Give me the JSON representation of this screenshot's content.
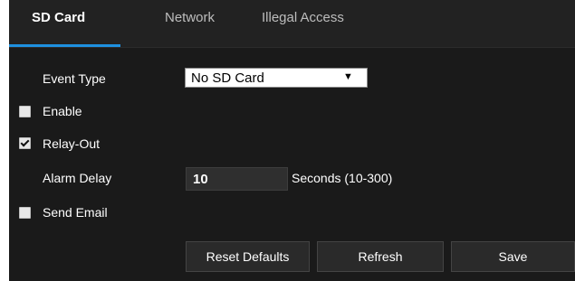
{
  "tabs": [
    {
      "label": "SD Card",
      "active": true
    },
    {
      "label": "Network",
      "active": false
    },
    {
      "label": "Illegal Access",
      "active": false
    }
  ],
  "form": {
    "event_type_label": "Event Type",
    "event_type_value": "No SD Card",
    "enable_label": "Enable",
    "enable_checked": false,
    "relay_out_label": "Relay-Out",
    "relay_out_checked": true,
    "alarm_delay_label": "Alarm Delay",
    "alarm_delay_value": "10",
    "alarm_delay_hint": "Seconds (10-300)",
    "send_email_label": "Send Email",
    "send_email_checked": false
  },
  "buttons": {
    "reset_label": "Reset Defaults",
    "refresh_label": "Refresh",
    "save_label": "Save"
  },
  "colors": {
    "background": "#1a1a1a",
    "tab_bar": "#222222",
    "active_tab_underline": "#1e90e0"
  }
}
